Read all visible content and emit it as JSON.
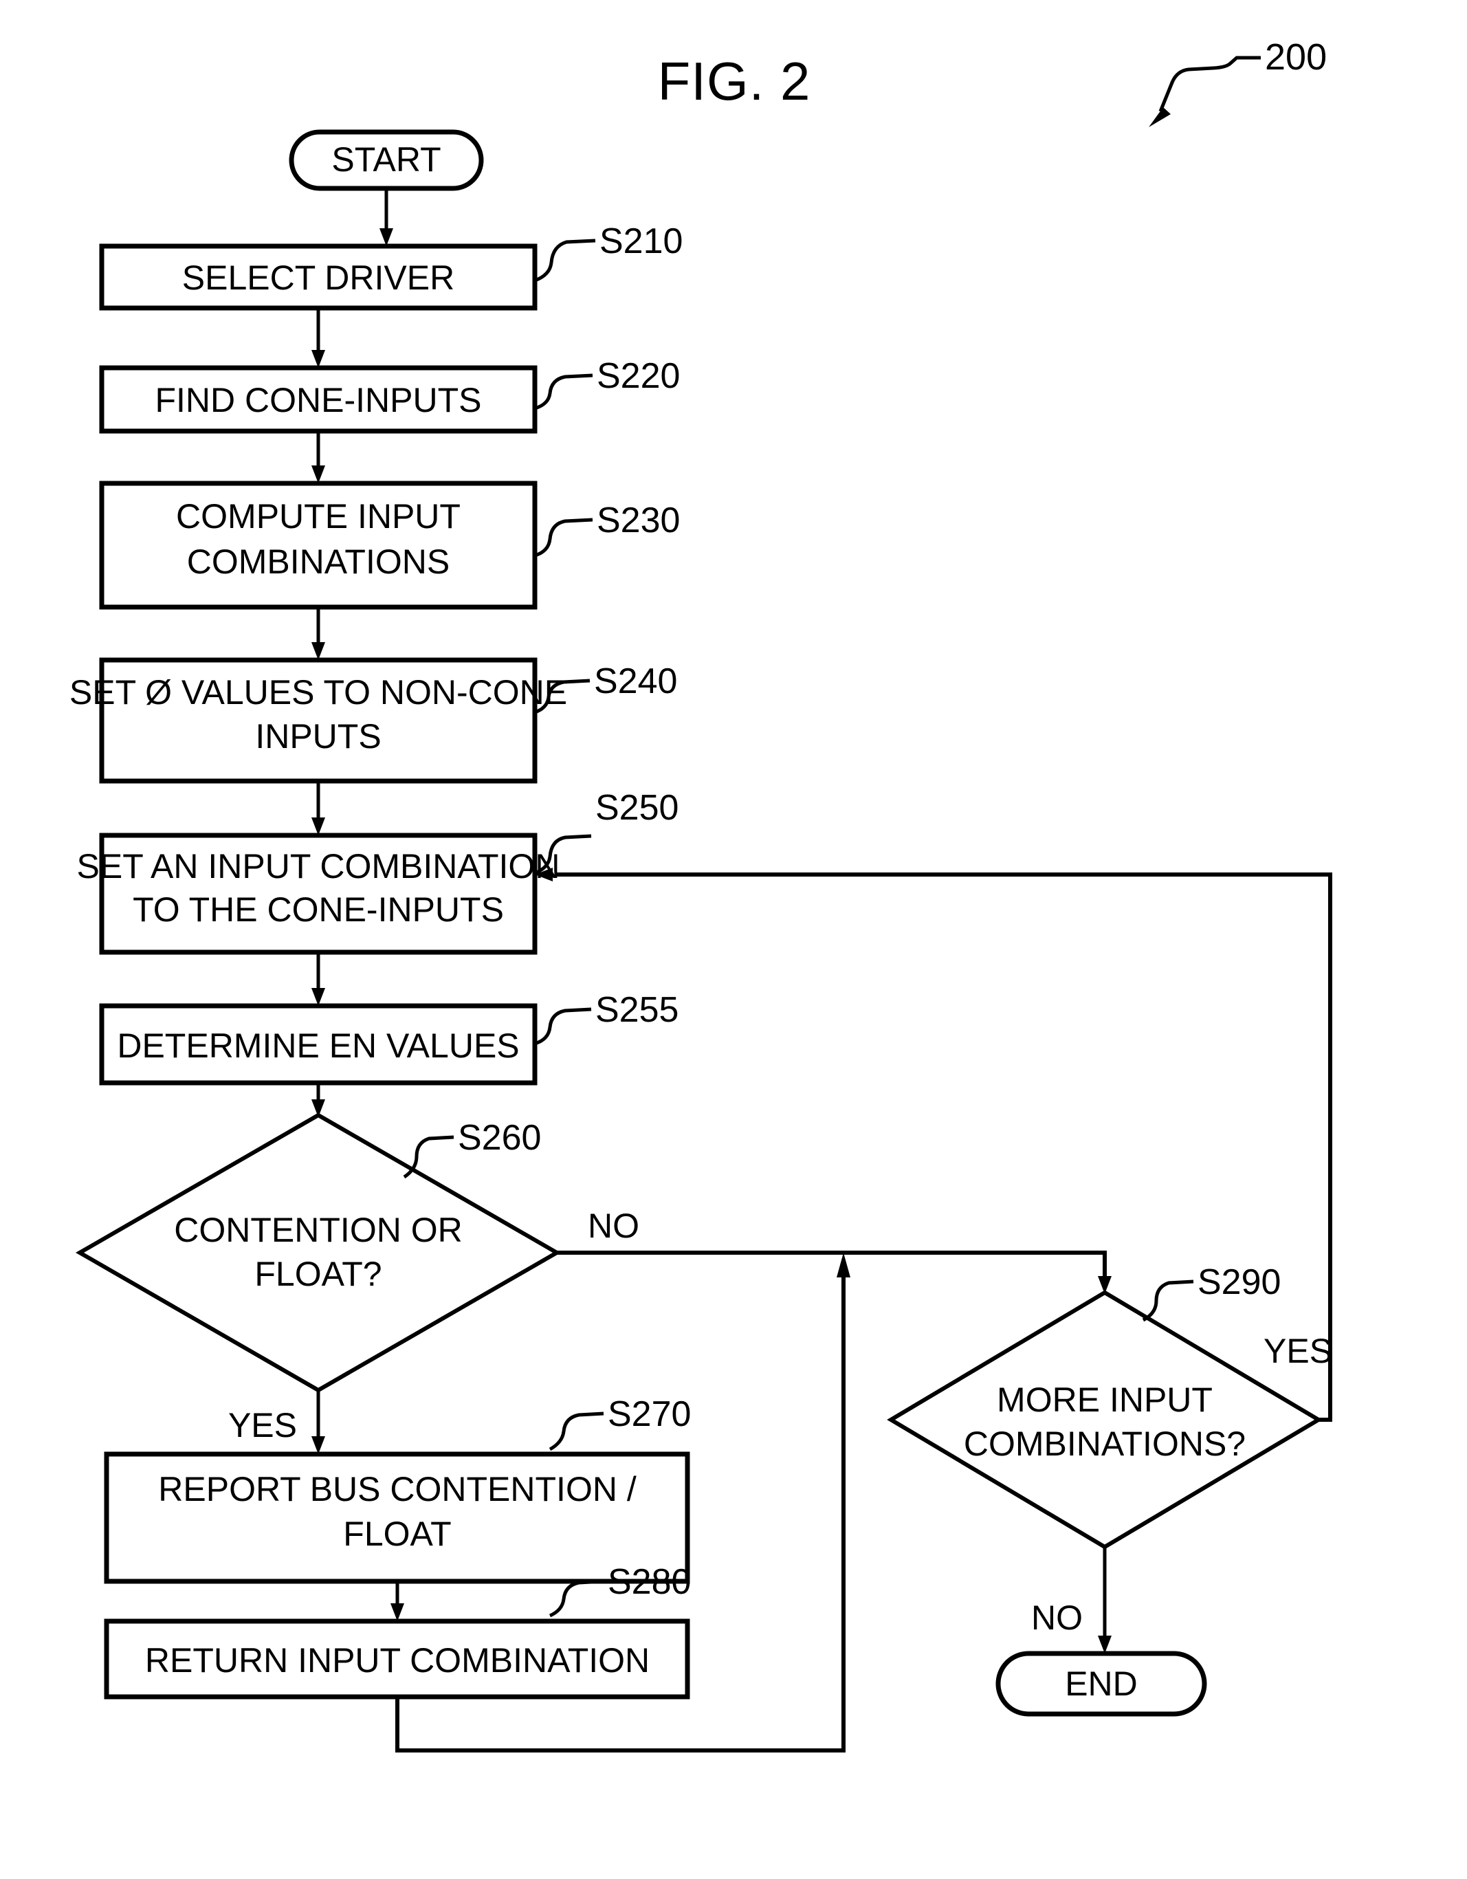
{
  "figure": {
    "title": "FIG. 2",
    "reference_numeral": "200"
  },
  "nodes": {
    "start": {
      "label": "START",
      "type": "terminator"
    },
    "s210": {
      "label": "SELECT DRIVER",
      "step": "S210",
      "type": "process"
    },
    "s220": {
      "label": "FIND CONE-INPUTS",
      "step": "S220",
      "type": "process"
    },
    "s230": {
      "line1": "COMPUTE INPUT",
      "line2": "COMBINATIONS",
      "step": "S230",
      "type": "process"
    },
    "s240": {
      "line1": "SET Ø VALUES TO NON-CONE",
      "line2": "INPUTS",
      "step": "S240",
      "type": "process"
    },
    "s250": {
      "line1": "SET AN INPUT COMBINATION",
      "line2": "TO THE CONE-INPUTS",
      "step": "S250",
      "type": "process"
    },
    "s255": {
      "label": "DETERMINE EN VALUES",
      "step": "S255",
      "type": "process"
    },
    "s260": {
      "line1": "CONTENTION OR",
      "line2": "FLOAT?",
      "step": "S260",
      "type": "decision"
    },
    "s270": {
      "line1": "REPORT BUS CONTENTION /",
      "line2": "FLOAT",
      "step": "S270",
      "type": "process"
    },
    "s280": {
      "label": "RETURN INPUT COMBINATION",
      "step": "S280",
      "type": "process"
    },
    "s290": {
      "line1": "MORE INPUT",
      "line2": "COMBINATIONS?",
      "step": "S290",
      "type": "decision"
    },
    "end": {
      "label": "END",
      "type": "terminator"
    }
  },
  "branch_labels": {
    "s260_no": "NO",
    "s260_yes": "YES",
    "s290_yes": "YES",
    "s290_no": "NO"
  },
  "colors": {
    "stroke": "#000000",
    "fill": "#ffffff"
  }
}
